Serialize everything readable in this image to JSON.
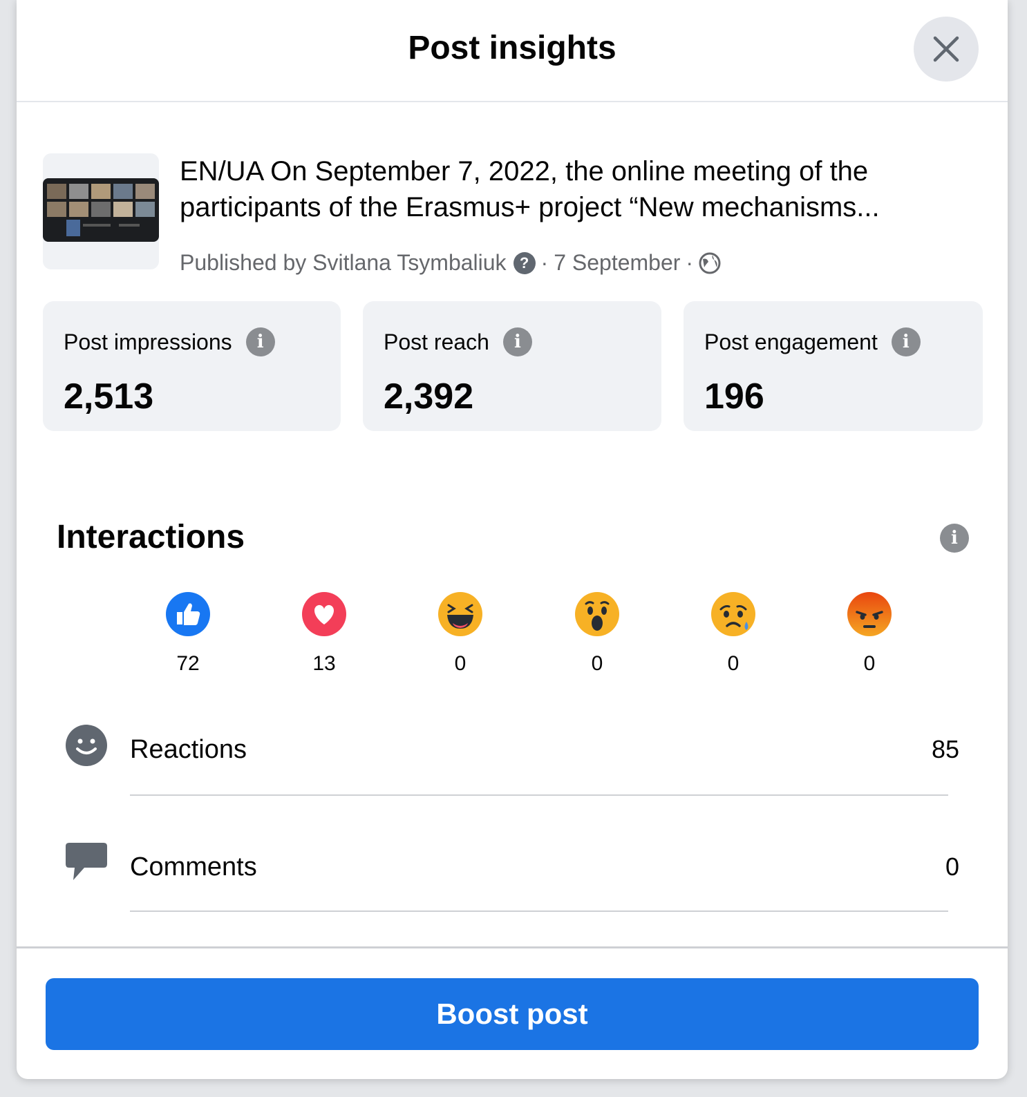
{
  "header": {
    "title": "Post insights",
    "close_icon": "close-icon"
  },
  "post": {
    "text_line1": "EN/UA On September 7, 2022, the online meeting of the",
    "text_line2": "participants of the Erasmus+ project “New mechanisms...",
    "published_by": "Published by Svitlana Tsymbaliuk",
    "date": "7 September",
    "audience_icon": "globe-icon"
  },
  "metrics": [
    {
      "label": "Post impressions",
      "value": "2,513"
    },
    {
      "label": "Post reach",
      "value": "2,392"
    },
    {
      "label": "Post engagement",
      "value": "196"
    }
  ],
  "interactions": {
    "title": "Interactions",
    "reactions": [
      {
        "type": "like",
        "count": "72",
        "color": "#1877f2"
      },
      {
        "type": "love",
        "count": "13",
        "color": "#f33e58"
      },
      {
        "type": "haha",
        "count": "0",
        "color": "#f7b125"
      },
      {
        "type": "wow",
        "count": "0",
        "color": "#f7b125"
      },
      {
        "type": "sad",
        "count": "0",
        "color": "#f7b125"
      },
      {
        "type": "angry",
        "count": "0",
        "color": "#e9710f"
      }
    ],
    "rows": [
      {
        "label": "Reactions",
        "value": "85",
        "icon": "smiley-icon"
      },
      {
        "label": "Comments",
        "value": "0",
        "icon": "comment-icon"
      }
    ]
  },
  "footer": {
    "boost_label": "Boost post"
  },
  "colors": {
    "primary": "#1b74e4",
    "card_bg": "#f0f2f5",
    "secondary_text": "#65676b"
  }
}
